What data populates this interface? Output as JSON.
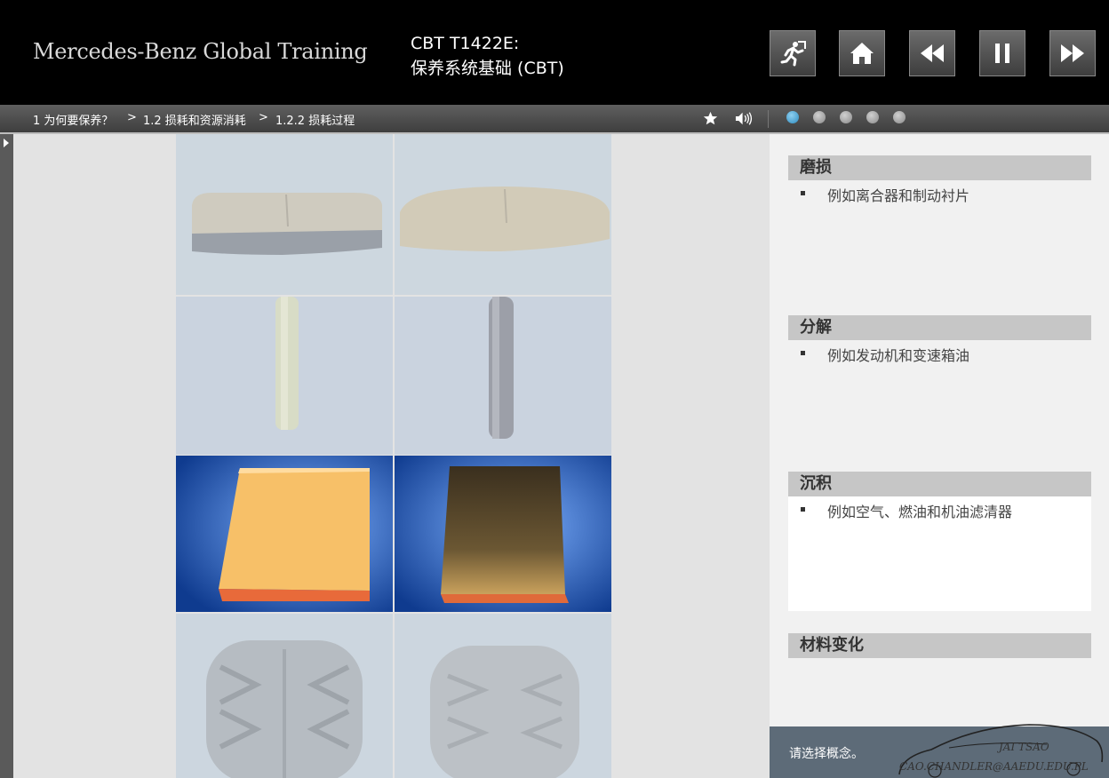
{
  "header": {
    "brand": "Mercedes-Benz Global Training",
    "course_code": "CBT T1422E:",
    "course_name": "保养系统基础 (CBT)",
    "buttons": [
      {
        "name": "exit-button",
        "icon": "running-man-exit-icon"
      },
      {
        "name": "home-button",
        "icon": "home-icon"
      },
      {
        "name": "previous-button",
        "icon": "rewind-icon"
      },
      {
        "name": "pause-button",
        "icon": "pause-icon"
      },
      {
        "name": "next-button",
        "icon": "fast-forward-icon"
      }
    ]
  },
  "breadcrumb": {
    "items": [
      "1 为何要保养？",
      "1.2 损耗和资源消耗",
      "1.2.2 损耗过程"
    ],
    "separator": ">"
  },
  "toolbar": {
    "icons": [
      "star-icon",
      "speaker-icon"
    ],
    "page_dots": 5,
    "active_dot": 1,
    "accent_color": "#3a9ad0"
  },
  "image_grid": {
    "rows": [
      {
        "subject": "brake-pads",
        "dimmed": true
      },
      {
        "subject": "engine-oil-tubes",
        "dimmed": true
      },
      {
        "subject": "air-filters",
        "dimmed": false
      },
      {
        "subject": "tires",
        "dimmed": true
      }
    ]
  },
  "concepts": [
    {
      "heading": "磨损",
      "text": "例如离合器和制动衬片",
      "selected": false
    },
    {
      "heading": "分解",
      "text": "例如发动机和变速箱油",
      "selected": false
    },
    {
      "heading": "沉积",
      "text": "例如空气、燃油和机油滤清器",
      "selected": true
    },
    {
      "heading": "材料变化",
      "text": "",
      "selected": false
    }
  ],
  "status": {
    "prompt": "请选择概念。"
  },
  "watermark": {
    "name": "JAI TSAO",
    "email": "CAO.CHANDLER@AAEDU.EDU.PL"
  }
}
